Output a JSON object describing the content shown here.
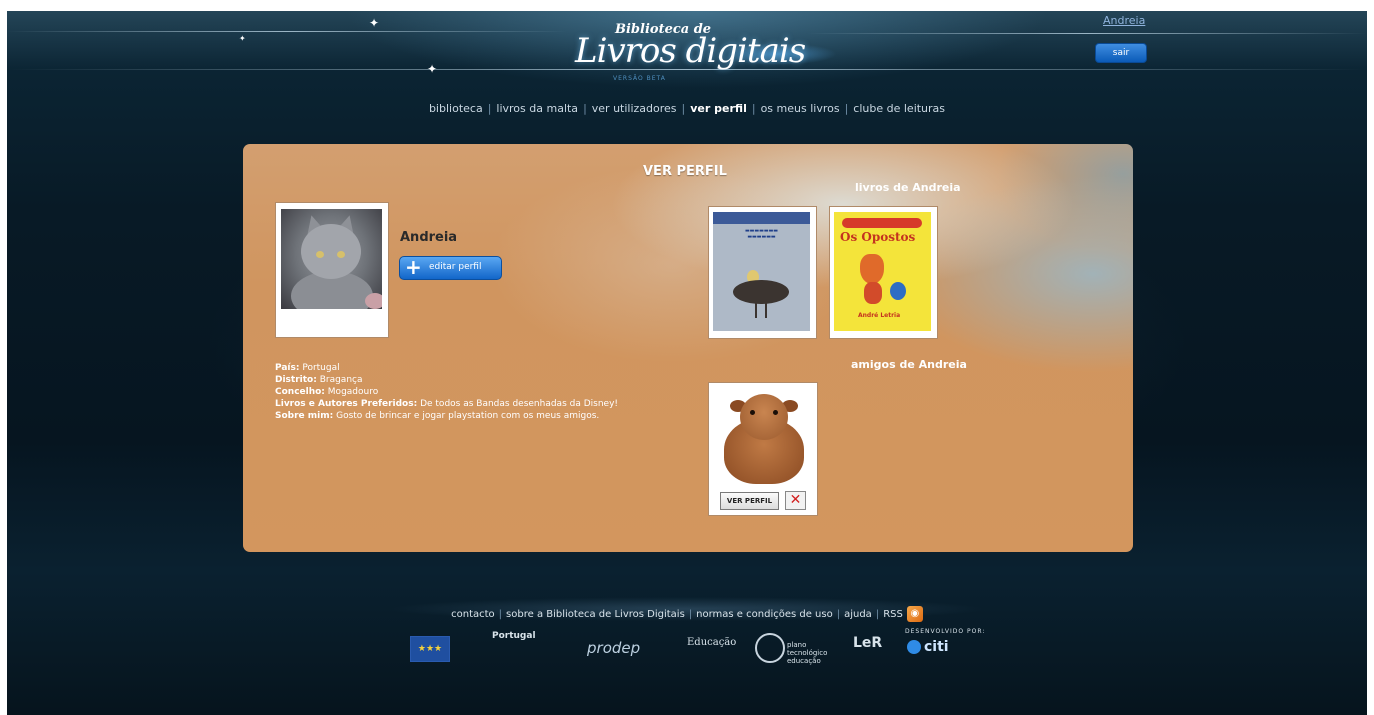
{
  "header": {
    "logo_top": "Biblioteca de",
    "logo_main": "Livros digitais",
    "logo_beta": "VERSÃO BETA",
    "user_name": "Andreia",
    "logout_label": "sair"
  },
  "nav": {
    "items": [
      {
        "label": "biblioteca"
      },
      {
        "label": "livros da malta"
      },
      {
        "label": "ver utilizadores"
      },
      {
        "label": "ver perfil",
        "active": true
      },
      {
        "label": "os meus livros"
      },
      {
        "label": "clube de leituras"
      }
    ]
  },
  "panel": {
    "title": "VER PERFIL",
    "profile_name": "Andreia",
    "edit_label": "editar perfil",
    "info": [
      {
        "label": "País:",
        "value": "Portugal"
      },
      {
        "label": "Distrito:",
        "value": "Bragança"
      },
      {
        "label": "Concelho:",
        "value": "Mogadouro"
      },
      {
        "label": "Livros e Autores Preferidos:",
        "value": "De todos as Bandas desenhadas da Disney!"
      },
      {
        "label": "Sobre mim:",
        "value": "Gosto de brincar e jogar playstation com os meus amigos."
      }
    ],
    "books_title": "livros de Andreia",
    "book2_title": "Os Opostos",
    "book2_author": "André Letria",
    "friends_title": "amigos de Andreia",
    "friend_view_label": "VER PERFIL",
    "friend_remove_label": "✕"
  },
  "footer": {
    "links": [
      {
        "label": "contacto"
      },
      {
        "label": "sobre a Biblioteca de Livros Digitais"
      },
      {
        "label": "normas e condições de uso"
      },
      {
        "label": "ajuda"
      },
      {
        "label": "RSS"
      }
    ],
    "logos": {
      "portugal": "Portugal",
      "prodep": "prodep",
      "educacao": "Educação",
      "pte": "plano tecnológico educação",
      "ler": "LeR",
      "dev": "DESENVOLVIDO POR:",
      "citi": "citi"
    }
  }
}
